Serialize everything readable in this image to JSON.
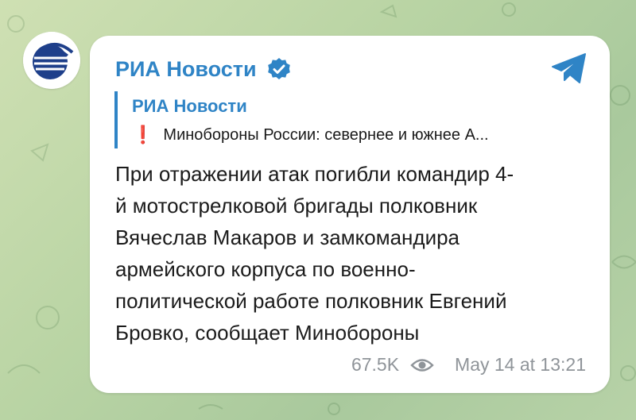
{
  "channel": {
    "name": "РИА Новости",
    "avatar_icon": "ria-novosti-logo",
    "verified_icon": "verified-badge-icon"
  },
  "share": {
    "icon": "telegram-share-icon"
  },
  "quote": {
    "author": "РИА Новости",
    "marker": "❗",
    "text": "Минобороны России: севернее и южнее А..."
  },
  "message": {
    "lines": [
      "При отражении атак погибли командир 4-",
      "й мотострелковой бригады полковник",
      "Вячеслав Макаров и замкомандира",
      "армейского корпуса по военно-",
      "политической работе полковник Евгений",
      "Бровко, сообщает Минобороны"
    ]
  },
  "meta": {
    "views": "67.5K",
    "views_icon": "eye-icon",
    "timestamp": "May 14 at 13:21"
  },
  "colors": {
    "accent": "#2f84c6",
    "alert": "#e01b24",
    "background": "#b9d4a4",
    "meta_text": "#8f9499"
  }
}
